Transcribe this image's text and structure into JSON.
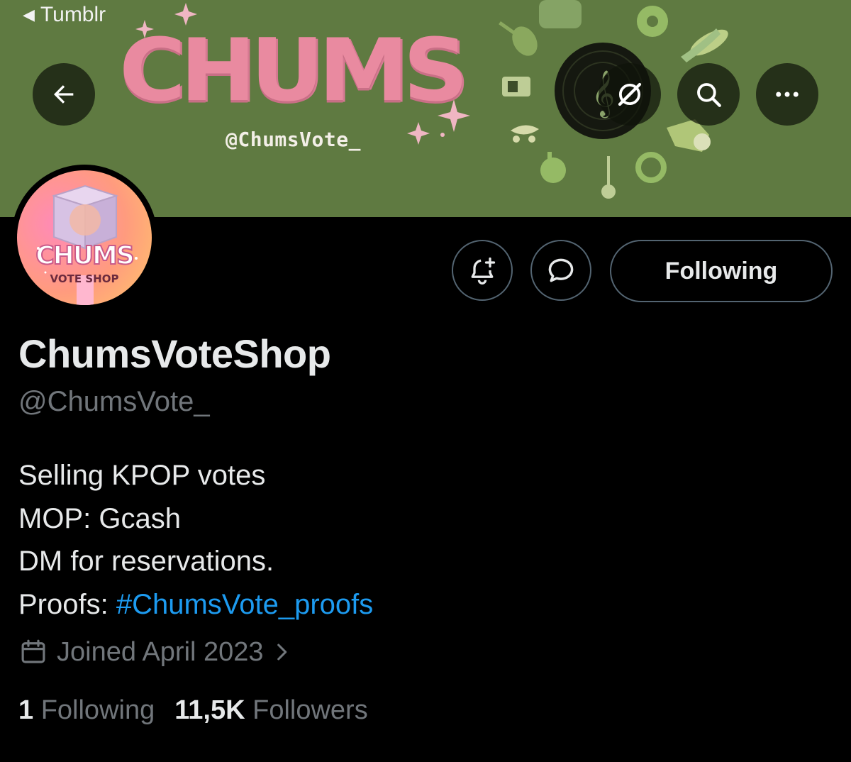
{
  "status_bar": {
    "back_app_label": "Tumblr"
  },
  "banner": {
    "title": "CHUMS",
    "handle": "@ChumsVote_"
  },
  "header_buttons": {
    "back_icon": "arrow-left-icon",
    "grok_icon": "slashed-circle-icon",
    "search_icon": "search-icon",
    "more_icon": "more-dots-icon"
  },
  "avatar": {
    "title": "CHUMS",
    "subtitle": "VOTE SHOP"
  },
  "actions": {
    "notify_icon": "bell-plus-icon",
    "message_icon": "message-bubble-icon",
    "following_label": "Following"
  },
  "profile": {
    "display_name": "ChumsVoteShop",
    "handle": "@ChumsVote_",
    "bio": {
      "line1": "Selling KPOP votes",
      "line2": "MOP: Gcash",
      "line3": "DM for reservations.",
      "line4_prefix": "Proofs: ",
      "line4_hashtag": "#ChumsVote_proofs"
    },
    "joined": "Joined April 2023",
    "following_count": "1",
    "following_label": "Following",
    "followers_count": "11,5K",
    "followers_label": "Followers"
  },
  "colors": {
    "banner": "#5f7a41",
    "accent_link": "#1d9bf0",
    "muted_text": "#71767b",
    "title_pink": "#e98aa0"
  }
}
